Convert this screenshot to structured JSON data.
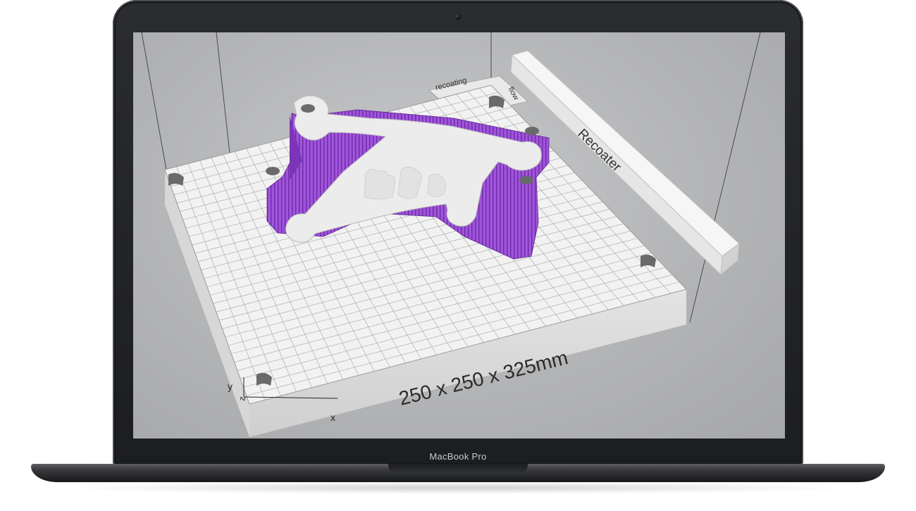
{
  "device": {
    "brand_label": "MacBook Pro"
  },
  "viewport": {
    "dimensions_label": "250 x 250 x 325mm",
    "recoater_label": "Recoater",
    "recoating_label": "recoating",
    "flow_label": "flow",
    "axis_x": "x",
    "axis_y": "y",
    "axis_z": "z"
  },
  "colors": {
    "background": "#b8b9bb",
    "platform": "#f2f2f2",
    "grid": "#9a9a9a",
    "support_structure": "#9b4fd6",
    "part": "#ececec",
    "bezel": "#1f2022"
  }
}
